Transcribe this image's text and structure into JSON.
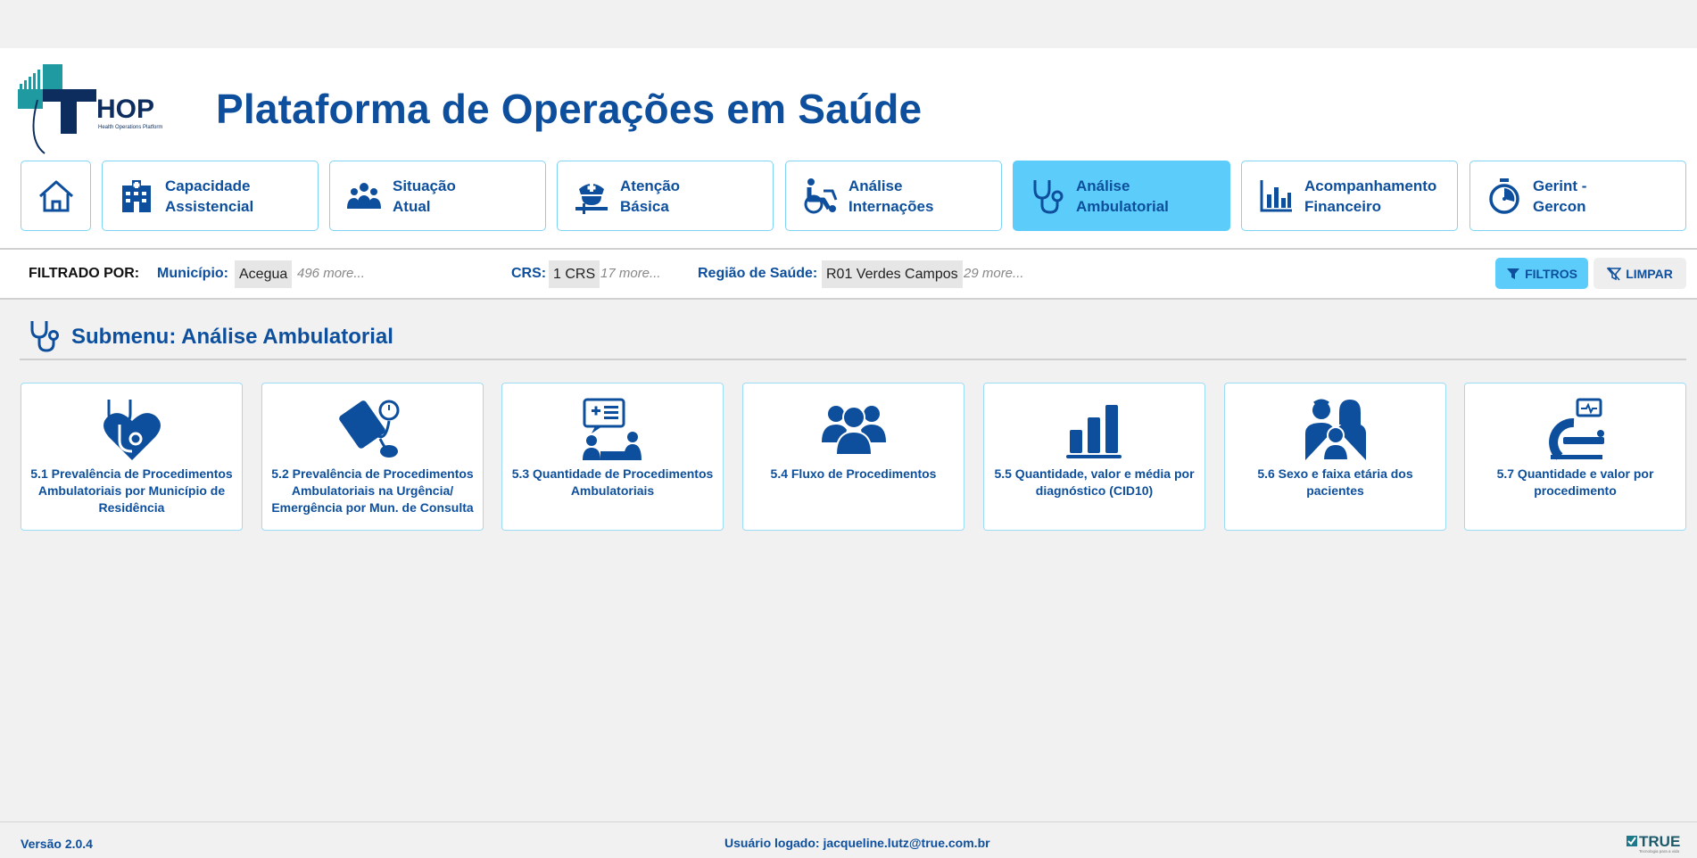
{
  "header": {
    "title": "Plataforma de Operações em Saúde",
    "logo": {
      "text": "HOP",
      "subtext": "Health Operations Platform"
    }
  },
  "nav": {
    "items": [
      {
        "label": "",
        "icon": "home-icon"
      },
      {
        "label": "Capacidade\nAssistencial",
        "icon": "hospital-icon"
      },
      {
        "label": "Situação\nAtual",
        "icon": "people-group-icon"
      },
      {
        "label": "Atenção\nBásica",
        "icon": "nurse-icon"
      },
      {
        "label": "Análise\nInternações",
        "icon": "wheelchair-icon"
      },
      {
        "label": "Análise\nAmbulatorial",
        "icon": "stethoscope-icon",
        "active": true
      },
      {
        "label": "Acompanhamento\nFinanceiro",
        "icon": "bar-chart-icon"
      },
      {
        "label": "Gerint -\nGercon",
        "icon": "stopwatch-icon"
      }
    ]
  },
  "filters": {
    "prefix": "FILTRADO POR:",
    "municipio": {
      "label": "Município:",
      "value": "Acegua",
      "more": "496 more..."
    },
    "crs": {
      "label": "CRS:",
      "value": "1 CRS",
      "more": "17 more..."
    },
    "regiao": {
      "label": "Região de Saúde:",
      "value": "R01 Verdes Campos",
      "more": "29 more..."
    },
    "filtros_button": "FILTROS",
    "limpar_button": "LIMPAR"
  },
  "submenu": {
    "title": "Submenu: Análise Ambulatorial"
  },
  "cards": [
    {
      "label": "5.1 Prevalência de Procedimentos Ambulatoriais por Município de Residência",
      "icon": "heart-stethoscope-icon"
    },
    {
      "label": "5.2 Prevalência de Procedimentos Ambulatoriais na Urgência/ Emergência por Mun. de Consulta",
      "icon": "blood-pressure-icon"
    },
    {
      "label": "5.3 Quantidade de Procedimentos Ambulatoriais",
      "icon": "consultation-icon"
    },
    {
      "label": "5.4 Fluxo de Procedimentos",
      "icon": "users-icon"
    },
    {
      "label": "5.5 Quantidade, valor e média por diagnóstico (CID10)",
      "icon": "bar-chart-icon"
    },
    {
      "label": "5.6 Sexo e faixa etária dos pacientes",
      "icon": "family-icon"
    },
    {
      "label": "5.7 Quantidade e valor por procedimento",
      "icon": "mri-scanner-icon"
    }
  ],
  "footer": {
    "version": "Versão 2.0.4",
    "user": "Usuário logado: jacqueline.lutz@true.com.br",
    "brand": "TRUE",
    "brand_tagline": "Tecnologia para a vida"
  },
  "colors": {
    "primary": "#0d4f9c",
    "accent": "#5ccdfb",
    "teal": "#1e9aa0"
  }
}
